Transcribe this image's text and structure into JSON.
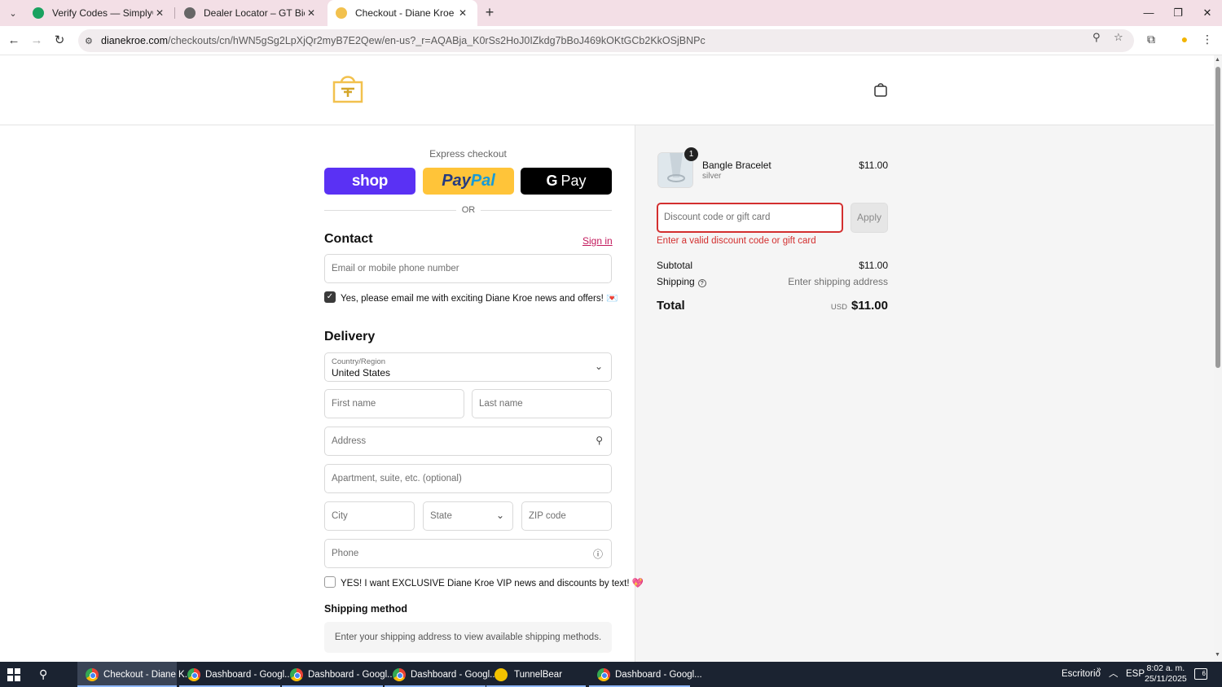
{
  "browser": {
    "tabs": [
      {
        "title": "Verify Codes — SimplyCodes",
        "favicon_color": "#1aa260"
      },
      {
        "title": "Dealer Locator – GT Bicycles",
        "favicon_color": "#666666"
      },
      {
        "title": "Checkout - Diane Kroe",
        "favicon_color": "#f2c14e"
      }
    ],
    "url_domain": "dianekroe.com",
    "url_path": "/checkouts/cn/hWN5gSg2LpXjQr2myB7E2Qew/en-us?_r=AQABja_K0rSs2HoJ0IZkdg7bBoJ469kOKtGCb2KkOSjBNPc"
  },
  "checkout": {
    "express_label": "Express checkout",
    "shop_label": "shop",
    "paypal_label_1": "Pay",
    "paypal_label_2": "Pal",
    "gpay_g": "G",
    "gpay_label": "Pay",
    "or_label": "OR",
    "contact_title": "Contact",
    "sign_in": "Sign in",
    "email_placeholder": "Email or mobile phone number",
    "email_optin_label": "Yes, please email me with exciting Diane Kroe news and offers! 💌",
    "email_optin_checked": true,
    "delivery_title": "Delivery",
    "country_label": "Country/Region",
    "country_value": "United States",
    "first_name_ph": "First name",
    "last_name_ph": "Last name",
    "address_ph": "Address",
    "apartment_ph": "Apartment, suite, etc. (optional)",
    "city_ph": "City",
    "state_ph": "State",
    "zip_ph": "ZIP code",
    "phone_ph": "Phone",
    "sms_optin_label": "YES! I want EXCLUSIVE Diane Kroe VIP news and discounts by text! 💖",
    "sms_optin_checked": false,
    "shipping_method_title": "Shipping method",
    "shipping_method_msg": "Enter your shipping address to view available shipping methods."
  },
  "summary": {
    "item": {
      "name": "Bangle Bracelet",
      "variant": "silver",
      "price": "$11.00",
      "qty": "1"
    },
    "discount_placeholder": "Discount code or gift card",
    "apply_label": "Apply",
    "discount_error": "Enter a valid discount code or gift card",
    "subtotal_label": "Subtotal",
    "subtotal_value": "$11.00",
    "shipping_label": "Shipping",
    "shipping_value": "Enter shipping address",
    "total_label": "Total",
    "total_currency": "USD",
    "total_value": "$11.00"
  },
  "taskbar": {
    "items": [
      {
        "label": "Checkout - Diane K..."
      },
      {
        "label": "Dashboard - Googl..."
      },
      {
        "label": "Dashboard - Googl..."
      },
      {
        "label": "Dashboard - Googl..."
      },
      {
        "label": "TunnelBear"
      },
      {
        "label": "Dashboard - Googl..."
      }
    ],
    "desktop_label": "Escritorio",
    "language": "ESP",
    "time": "8:02 a. m.",
    "date": "25/11/2025",
    "notification_count": "6"
  },
  "colors": {
    "accent_pink": "#c2185b",
    "error_red": "#d32f2f",
    "shop_purple": "#5a31f4",
    "paypal_yellow": "#ffc439"
  }
}
